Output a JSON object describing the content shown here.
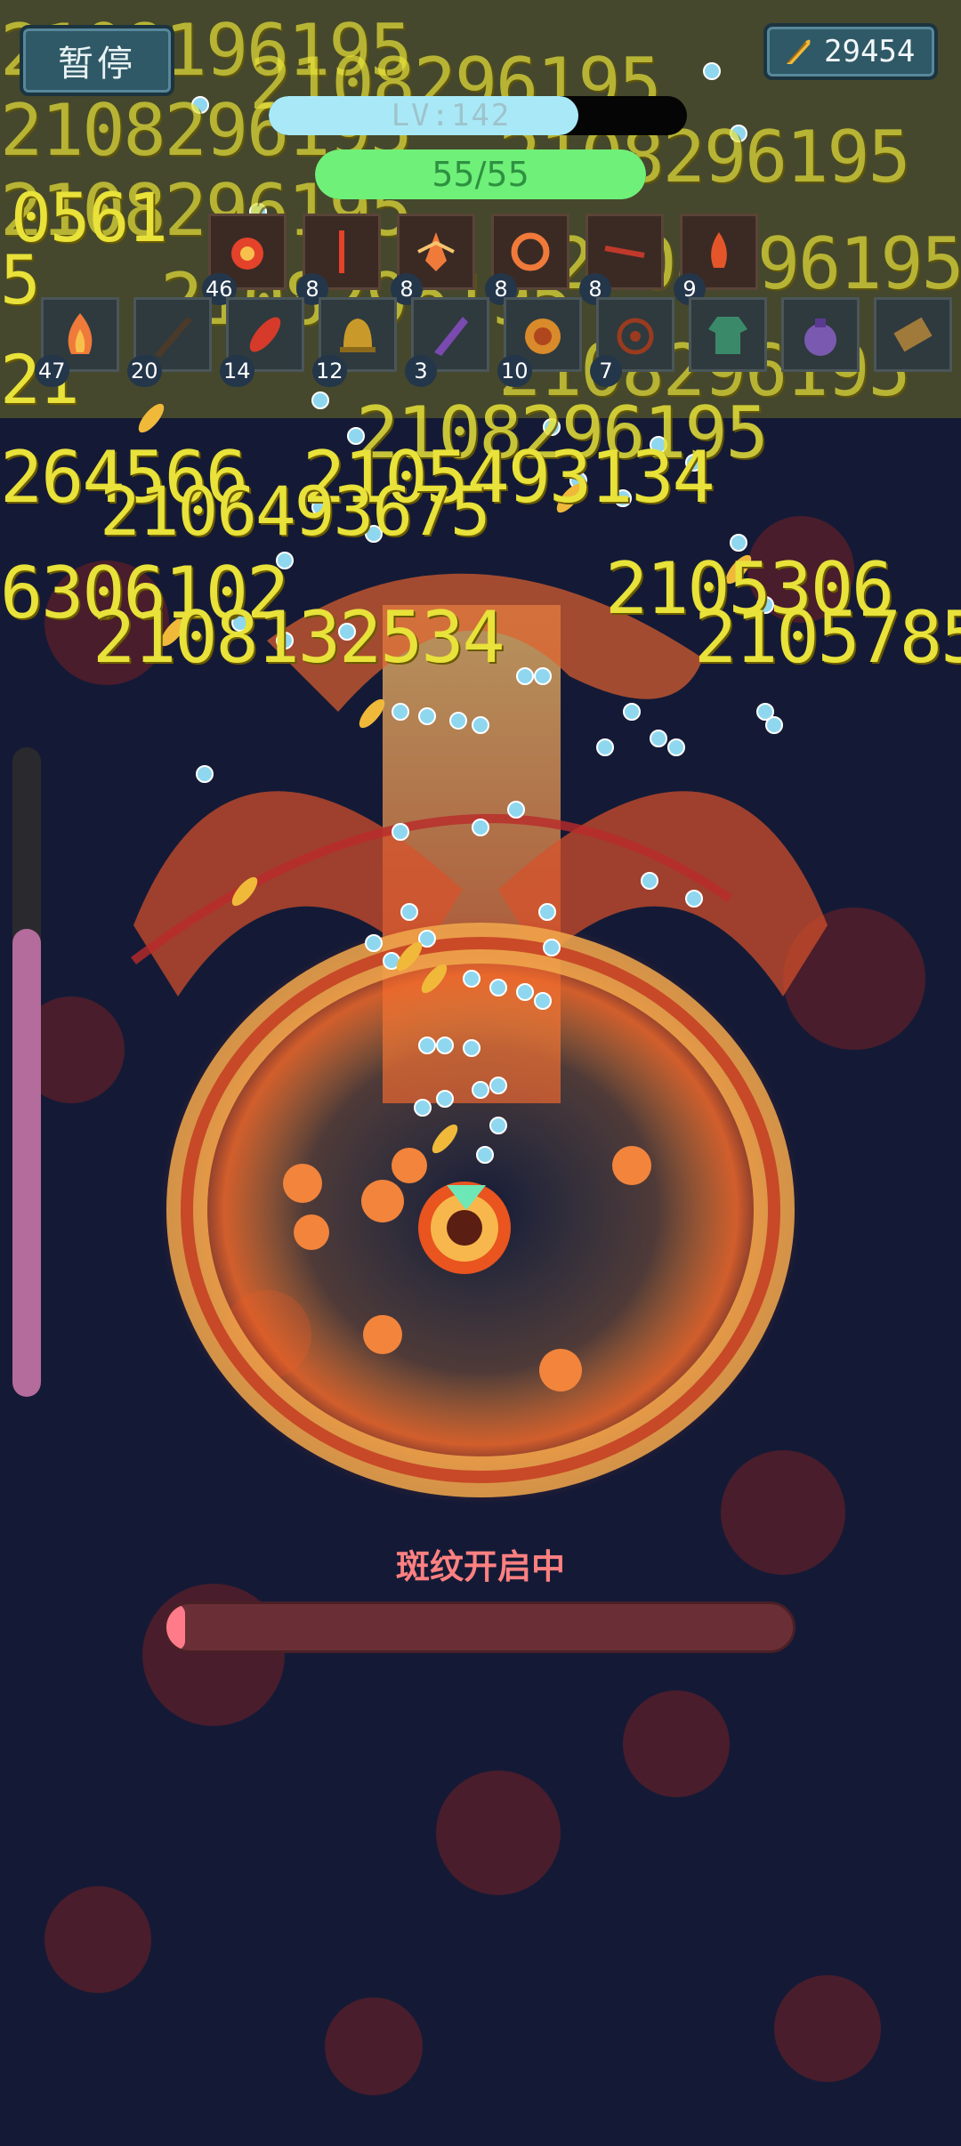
{
  "top_bar": {
    "pause_label": "暂停",
    "coin_amount": "29454"
  },
  "level": {
    "text": "LV:142",
    "progress": 0.74
  },
  "health": {
    "text": "55/55",
    "fraction": 1.0
  },
  "skills": [
    {
      "icon": "fire-burst-icon",
      "level": "46"
    },
    {
      "icon": "red-blade-icon",
      "level": "8"
    },
    {
      "icon": "phoenix-flame-icon",
      "level": "8"
    },
    {
      "icon": "fire-ring-icon",
      "level": "8"
    },
    {
      "icon": "fire-slash-icon",
      "level": "8"
    },
    {
      "icon": "flame-pillar-icon",
      "level": "9"
    }
  ],
  "items": [
    {
      "icon": "flame-icon",
      "level": "47"
    },
    {
      "icon": "dagger-icon",
      "level": "20"
    },
    {
      "icon": "red-feather-icon",
      "level": "14"
    },
    {
      "icon": "bell-icon",
      "level": "12"
    },
    {
      "icon": "purple-crystal-icon",
      "level": "3"
    },
    {
      "icon": "gold-medal-icon",
      "level": "10"
    },
    {
      "icon": "talisman-icon",
      "level": "7"
    },
    {
      "icon": "green-robe-icon"
    },
    {
      "icon": "purple-pouch-icon"
    },
    {
      "icon": "scroll-icon"
    }
  ],
  "damage_numbers": [
    "2108196195",
    "2108296195",
    "2108296195",
    "2108296195",
    "2108296195",
    "2108296195",
    "2108296195",
    "2108296195",
    "0561",
    "5",
    "21",
    "2108296195",
    "264566",
    "2105493134",
    "2106493675",
    "6306102",
    "2105306",
    "2108132534",
    "2105785"
  ],
  "side_gauge": {
    "fraction": 0.72
  },
  "status": {
    "text": "斑纹开启中"
  },
  "status_progress": {
    "fraction": 0.03
  },
  "colors": {
    "background": "#141a36",
    "damage_text": "#e8e23a",
    "hp_fill": "#6ff079",
    "lv_fill": "#a9e9f7",
    "status_text": "#ff8080"
  }
}
